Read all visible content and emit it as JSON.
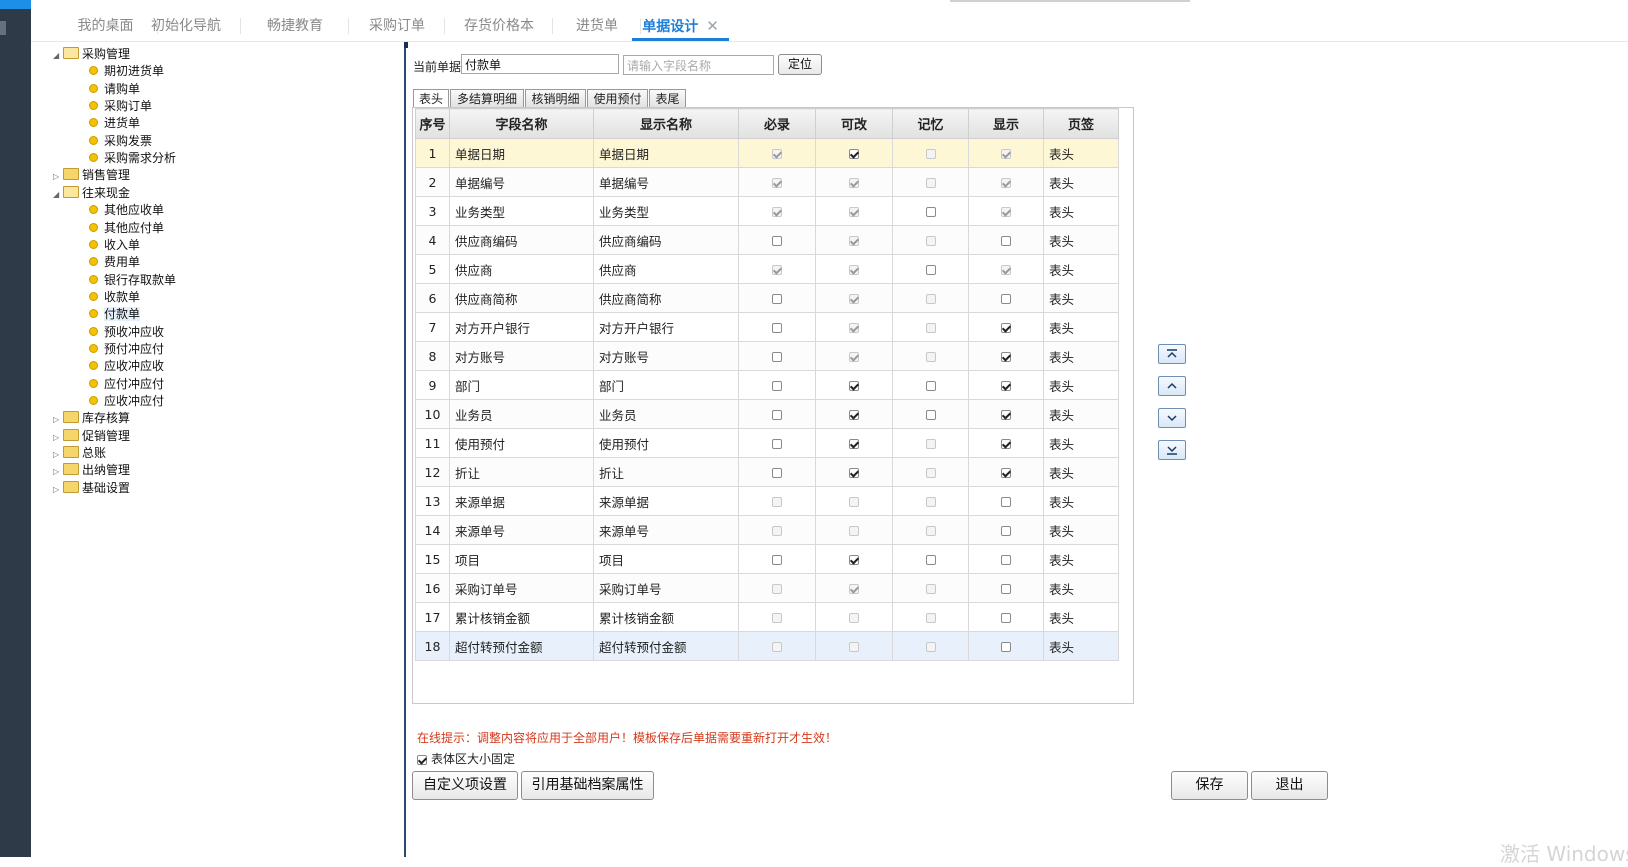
{
  "tabs": [
    {
      "label": "我的桌面"
    },
    {
      "label": "初始化导航"
    },
    {
      "label": "畅捷教育"
    },
    {
      "label": "采购订单"
    },
    {
      "label": "存货价格本"
    },
    {
      "label": "进货单"
    },
    {
      "label": "单据设计",
      "close": "✕"
    }
  ],
  "tree": [
    {
      "label": "采购管理",
      "type": "folder",
      "open": true
    },
    {
      "label": "期初进货单",
      "type": "leaf"
    },
    {
      "label": "请购单",
      "type": "leaf"
    },
    {
      "label": "采购订单",
      "type": "leaf"
    },
    {
      "label": "进货单",
      "type": "leaf"
    },
    {
      "label": "采购发票",
      "type": "leaf"
    },
    {
      "label": "采购需求分析",
      "type": "leaf"
    },
    {
      "label": "销售管理",
      "type": "folder",
      "open": false
    },
    {
      "label": "往来现金",
      "type": "folder",
      "open": true
    },
    {
      "label": "其他应收单",
      "type": "leaf"
    },
    {
      "label": "其他应付单",
      "type": "leaf"
    },
    {
      "label": "收入单",
      "type": "leaf"
    },
    {
      "label": "费用单",
      "type": "leaf"
    },
    {
      "label": "银行存取款单",
      "type": "leaf"
    },
    {
      "label": "收款单",
      "type": "leaf"
    },
    {
      "label": "付款单",
      "type": "leaf",
      "selected": true
    },
    {
      "label": "预收冲应收",
      "type": "leaf"
    },
    {
      "label": "预付冲应付",
      "type": "leaf"
    },
    {
      "label": "应收冲应收",
      "type": "leaf"
    },
    {
      "label": "应付冲应付",
      "type": "leaf"
    },
    {
      "label": "应收冲应付",
      "type": "leaf"
    },
    {
      "label": "库存核算",
      "type": "folder",
      "open": false
    },
    {
      "label": "促销管理",
      "type": "folder",
      "open": false
    },
    {
      "label": "总账",
      "type": "folder",
      "open": false
    },
    {
      "label": "出纳管理",
      "type": "folder",
      "open": false
    },
    {
      "label": "基础设置",
      "type": "folder",
      "open": false
    }
  ],
  "form": {
    "current_label": "当前单据",
    "current_value": "付款单",
    "search_placeholder": "请输入字段名称",
    "locate_label": "定位"
  },
  "subtabs": [
    "表头",
    "多结算明细",
    "核销明细",
    "使用预付",
    "表尾"
  ],
  "grid": {
    "headers": [
      "序号",
      "字段名称",
      "显示名称",
      "必录",
      "可改",
      "记忆",
      "显示",
      "页签"
    ],
    "rows": [
      {
        "no": "1",
        "field": "单据日期",
        "display": "单据日期",
        "req": [
          1,
          1
        ],
        "edit": [
          1,
          0
        ],
        "mem": [
          0,
          1
        ],
        "show": [
          1,
          1
        ],
        "tab": "表头"
      },
      {
        "no": "2",
        "field": "单据编号",
        "display": "单据编号",
        "req": [
          1,
          1
        ],
        "edit": [
          1,
          1
        ],
        "mem": [
          0,
          1
        ],
        "show": [
          1,
          1
        ],
        "tab": "表头"
      },
      {
        "no": "3",
        "field": "业务类型",
        "display": "业务类型",
        "req": [
          1,
          1
        ],
        "edit": [
          1,
          1
        ],
        "mem": [
          0,
          0
        ],
        "show": [
          1,
          1
        ],
        "tab": "表头"
      },
      {
        "no": "4",
        "field": "供应商编码",
        "display": "供应商编码",
        "req": [
          0,
          0
        ],
        "edit": [
          1,
          1
        ],
        "mem": [
          0,
          1
        ],
        "show": [
          0,
          0
        ],
        "tab": "表头"
      },
      {
        "no": "5",
        "field": "供应商",
        "display": "供应商",
        "req": [
          1,
          1
        ],
        "edit": [
          1,
          1
        ],
        "mem": [
          0,
          0
        ],
        "show": [
          1,
          1
        ],
        "tab": "表头"
      },
      {
        "no": "6",
        "field": "供应商简称",
        "display": "供应商简称",
        "req": [
          0,
          0
        ],
        "edit": [
          1,
          1
        ],
        "mem": [
          0,
          1
        ],
        "show": [
          0,
          0
        ],
        "tab": "表头"
      },
      {
        "no": "7",
        "field": "对方开户银行",
        "display": "对方开户银行",
        "req": [
          0,
          0
        ],
        "edit": [
          1,
          1
        ],
        "mem": [
          0,
          1
        ],
        "show": [
          1,
          0
        ],
        "tab": "表头"
      },
      {
        "no": "8",
        "field": "对方账号",
        "display": "对方账号",
        "req": [
          0,
          0
        ],
        "edit": [
          1,
          1
        ],
        "mem": [
          0,
          1
        ],
        "show": [
          1,
          0
        ],
        "tab": "表头"
      },
      {
        "no": "9",
        "field": "部门",
        "display": "部门",
        "req": [
          0,
          0
        ],
        "edit": [
          1,
          0
        ],
        "mem": [
          0,
          0
        ],
        "show": [
          1,
          0
        ],
        "tab": "表头"
      },
      {
        "no": "10",
        "field": "业务员",
        "display": "业务员",
        "req": [
          0,
          0
        ],
        "edit": [
          1,
          0
        ],
        "mem": [
          0,
          0
        ],
        "show": [
          1,
          0
        ],
        "tab": "表头"
      },
      {
        "no": "11",
        "field": "使用预付",
        "display": "使用预付",
        "req": [
          0,
          0
        ],
        "edit": [
          1,
          0
        ],
        "mem": [
          0,
          1
        ],
        "show": [
          1,
          0
        ],
        "tab": "表头"
      },
      {
        "no": "12",
        "field": "折让",
        "display": "折让",
        "req": [
          0,
          0
        ],
        "edit": [
          1,
          0
        ],
        "mem": [
          0,
          1
        ],
        "show": [
          1,
          0
        ],
        "tab": "表头"
      },
      {
        "no": "13",
        "field": "来源单据",
        "display": "来源单据",
        "req": [
          0,
          1
        ],
        "edit": [
          0,
          1
        ],
        "mem": [
          0,
          1
        ],
        "show": [
          0,
          0
        ],
        "tab": "表头"
      },
      {
        "no": "14",
        "field": "来源单号",
        "display": "来源单号",
        "req": [
          0,
          1
        ],
        "edit": [
          0,
          1
        ],
        "mem": [
          0,
          1
        ],
        "show": [
          0,
          0
        ],
        "tab": "表头"
      },
      {
        "no": "15",
        "field": "项目",
        "display": "项目",
        "req": [
          0,
          0
        ],
        "edit": [
          1,
          0
        ],
        "mem": [
          0,
          0
        ],
        "show": [
          0,
          0
        ],
        "tab": "表头"
      },
      {
        "no": "16",
        "field": "采购订单号",
        "display": "采购订单号",
        "req": [
          0,
          1
        ],
        "edit": [
          1,
          1
        ],
        "mem": [
          0,
          1
        ],
        "show": [
          0,
          0
        ],
        "tab": "表头"
      },
      {
        "no": "17",
        "field": "累计核销金额",
        "display": "累计核销金额",
        "req": [
          0,
          1
        ],
        "edit": [
          0,
          1
        ],
        "mem": [
          0,
          1
        ],
        "show": [
          0,
          0
        ],
        "tab": "表头"
      },
      {
        "no": "18",
        "field": "超付转预付金额",
        "display": "超付转预付金额",
        "req": [
          0,
          1
        ],
        "edit": [
          0,
          1
        ],
        "mem": [
          0,
          1
        ],
        "show": [
          0,
          0
        ],
        "tab": "表头"
      }
    ]
  },
  "tip": "在线提示：调整内容将应用于全部用户！模板保存后单据需要重新打开才生效！",
  "fixed_label": "表体区大小固定",
  "buttons": {
    "custom": "自定义项设置",
    "ref": "引用基础档案属性",
    "save": "保存",
    "exit": "退出"
  },
  "watermark": "激活 Windows"
}
